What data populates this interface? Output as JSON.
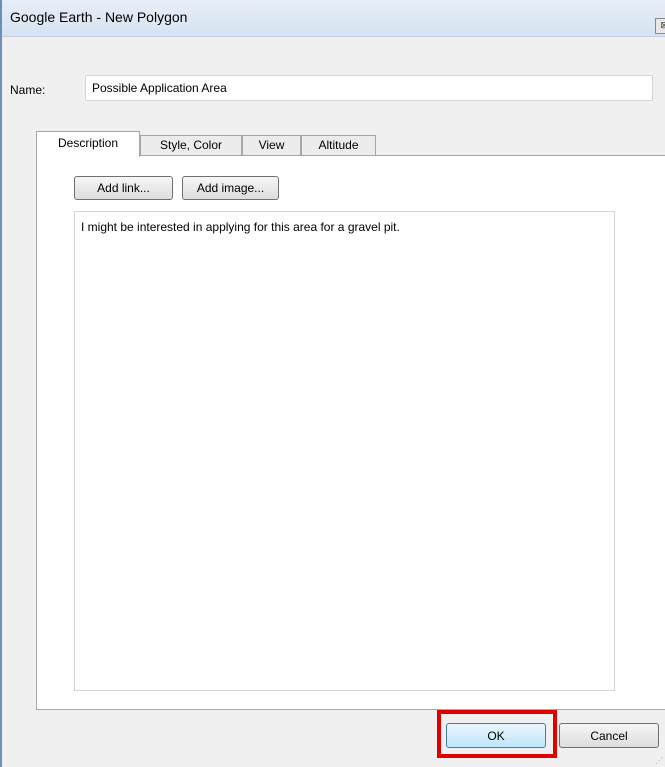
{
  "window": {
    "title": "Google Earth - New Polygon",
    "close_glyph": "⊠"
  },
  "name_field": {
    "label": "Name:",
    "value": "Possible Application Area"
  },
  "tabs": [
    {
      "label": "Description",
      "active": true
    },
    {
      "label": "Style, Color",
      "active": false
    },
    {
      "label": "View",
      "active": false
    },
    {
      "label": "Altitude",
      "active": false
    }
  ],
  "description": {
    "add_link_label": "Add link...",
    "add_image_label": "Add image...",
    "text": "I might be interested in applying for this area for a gravel pit."
  },
  "buttons": {
    "ok_label": "OK",
    "cancel_label": "Cancel"
  },
  "colors": {
    "highlight": "#e00000",
    "titlebar": "#dbe6f4"
  }
}
